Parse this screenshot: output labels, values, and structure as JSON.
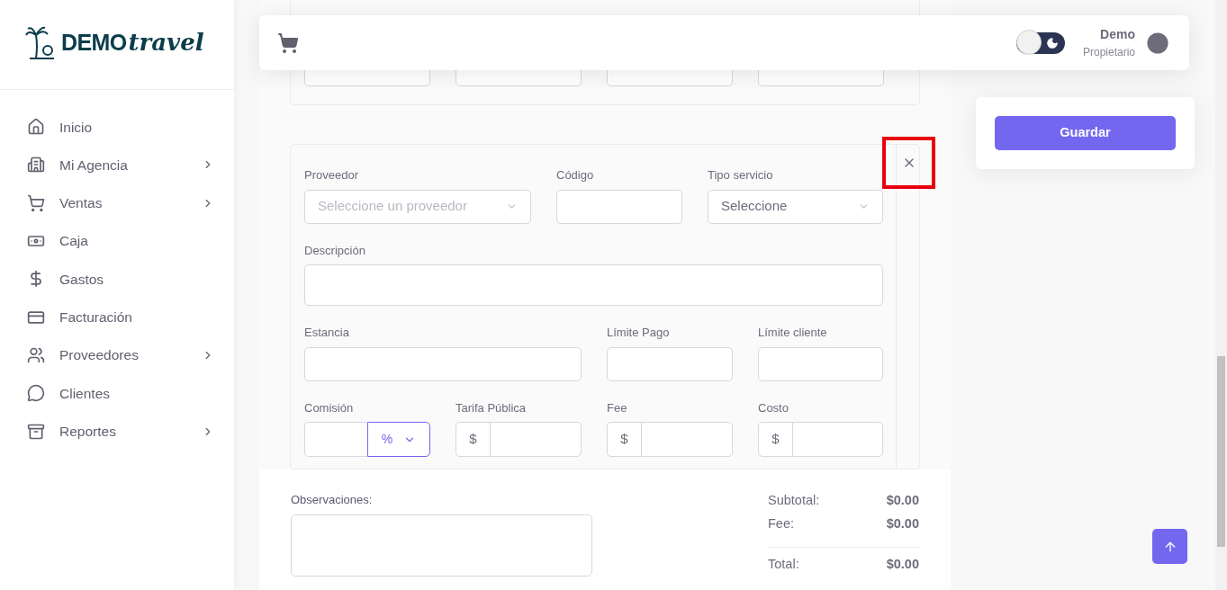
{
  "logo": {
    "brand": "DEMO",
    "script": "travel"
  },
  "sidebar": {
    "items": [
      {
        "label": "Inicio",
        "has_submenu": false
      },
      {
        "label": "Mi Agencia",
        "has_submenu": true
      },
      {
        "label": "Ventas",
        "has_submenu": true
      },
      {
        "label": "Caja",
        "has_submenu": false
      },
      {
        "label": "Gastos",
        "has_submenu": false
      },
      {
        "label": "Facturación",
        "has_submenu": false
      },
      {
        "label": "Proveedores",
        "has_submenu": true
      },
      {
        "label": "Clientes",
        "has_submenu": false
      },
      {
        "label": "Reportes",
        "has_submenu": true
      }
    ]
  },
  "header": {
    "dark_mode": false,
    "user_name": "Demo",
    "user_role": "Propietario"
  },
  "service_card": {
    "close_highlighted": true,
    "rows": [
      [
        {
          "kind": "select",
          "label": "Proveedor",
          "placeholder": "Seleccione un proveedor"
        },
        {
          "kind": "input",
          "label": "Código"
        },
        {
          "kind": "select",
          "label": "Tipo servicio",
          "value": "Seleccione"
        }
      ],
      [
        {
          "kind": "textarea",
          "label": "Descripción"
        }
      ],
      [
        {
          "kind": "input",
          "label": "Estancia"
        },
        {
          "kind": "input",
          "label": "Límite Pago"
        },
        {
          "kind": "input",
          "label": "Límite cliente"
        }
      ],
      [
        {
          "kind": "commission",
          "label": "Comisión",
          "unit": "%"
        },
        {
          "kind": "money",
          "label": "Tarifa Pública",
          "prefix": "$"
        },
        {
          "kind": "money",
          "label": "Fee",
          "prefix": "$"
        },
        {
          "kind": "money",
          "label": "Costo",
          "prefix": "$"
        }
      ]
    ]
  },
  "observations": {
    "label": "Observaciones:"
  },
  "totals": [
    {
      "label": "Subtotal:",
      "value": "$0.00",
      "kind": "line"
    },
    {
      "label": "Fee:",
      "value": "$0.00",
      "kind": "line"
    },
    {
      "label": "Total:",
      "value": "$0.00",
      "kind": "total"
    }
  ],
  "save_button": "Guardar"
}
